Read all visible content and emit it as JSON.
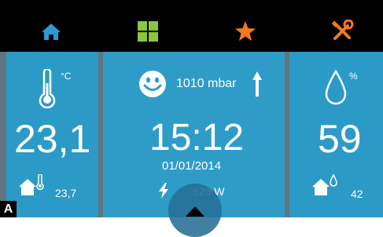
{
  "topbar": {
    "tabs": [
      {
        "icon": "home-icon",
        "color": "#2d9ad3"
      },
      {
        "icon": "grid-icon",
        "color": "#8cc63e"
      },
      {
        "icon": "star-icon",
        "color": "#f37a20"
      },
      {
        "icon": "tools-icon",
        "color": "#f37a20"
      }
    ]
  },
  "temperature": {
    "unit": "°C",
    "value": "23,1",
    "indoor_value": "23,7"
  },
  "center": {
    "pressure": "1010",
    "pressure_unit": "mbar",
    "time": "15:12",
    "date": "01/01/2014",
    "power": "523 W"
  },
  "humidity": {
    "unit": "%",
    "value": "59",
    "indoor_value": "42"
  },
  "figure_label": "A",
  "colors": {
    "panel": "#2c9ac6",
    "divider": "#5f7682",
    "topbar": "#000000",
    "text": "#ffffff"
  }
}
